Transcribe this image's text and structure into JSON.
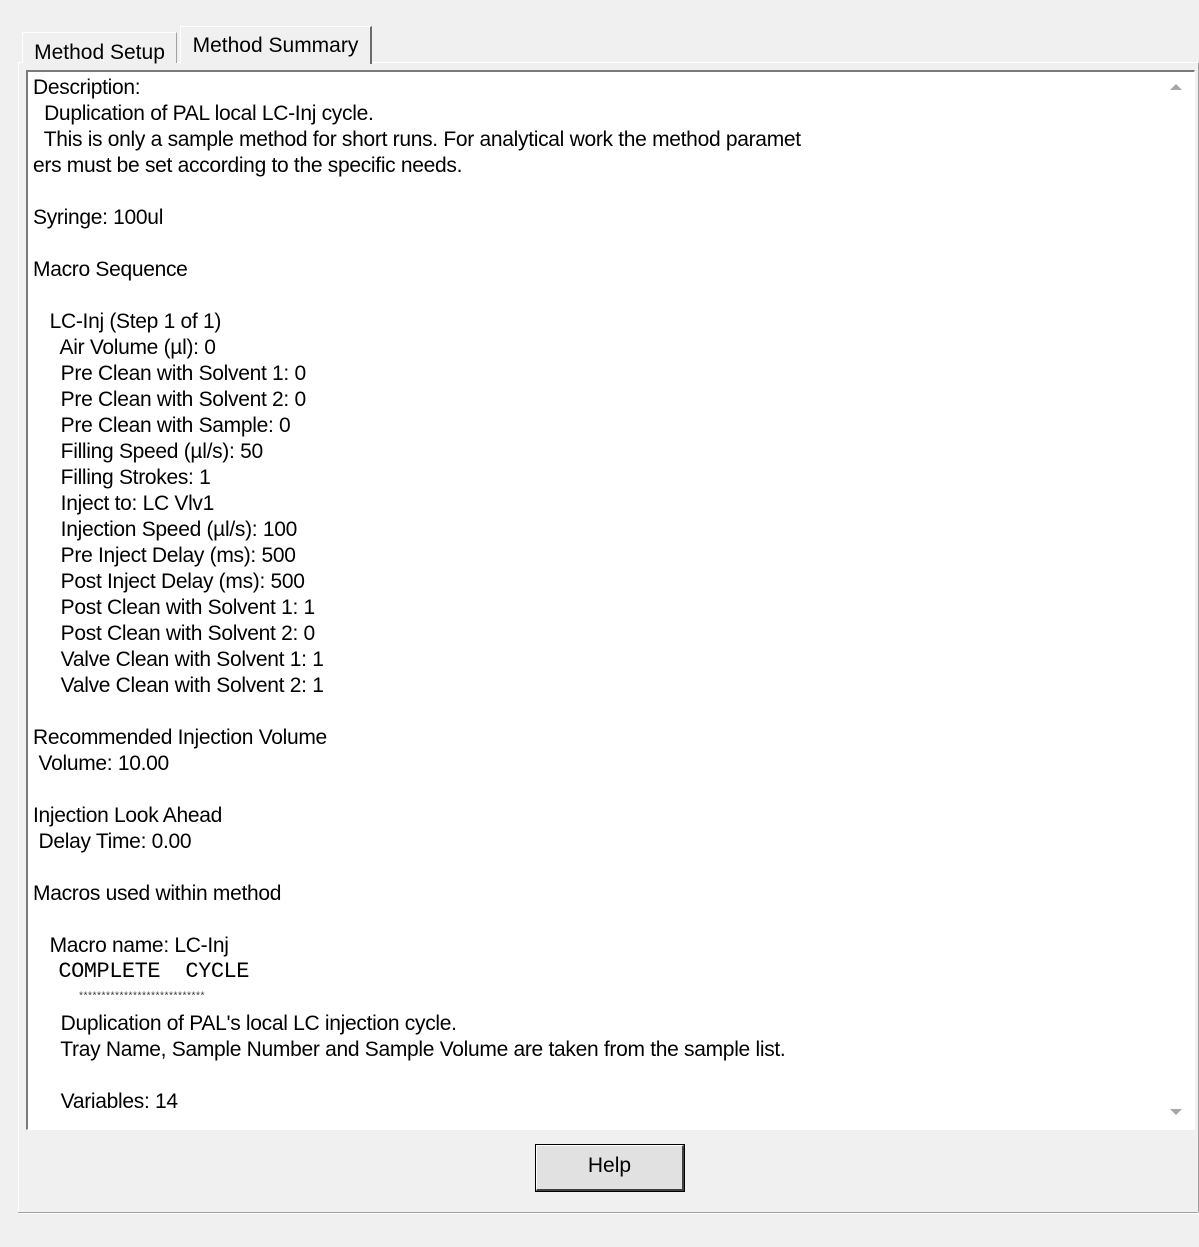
{
  "tabs": [
    {
      "label": "Method Setup",
      "active": false
    },
    {
      "label": "Method Summary",
      "active": true
    }
  ],
  "summary": {
    "lines": [
      {
        "text": "Description:",
        "style": "normal"
      },
      {
        "text": "  Duplication of PAL local LC-Inj cycle.",
        "style": "normal"
      },
      {
        "text": "  This is only a sample method for short runs. For analytical work the method paramet",
        "style": "normal"
      },
      {
        "text": "ers must be set according to the specific needs.",
        "style": "normal"
      },
      {
        "text": "",
        "style": "normal"
      },
      {
        "text": "Syringe: 100ul",
        "style": "normal"
      },
      {
        "text": "",
        "style": "normal"
      },
      {
        "text": "Macro Sequence",
        "style": "normal"
      },
      {
        "text": "",
        "style": "normal"
      },
      {
        "text": "   LC-Inj (Step 1 of 1)",
        "style": "normal"
      },
      {
        "text": "     Air Volume (µl): 0",
        "style": "normal"
      },
      {
        "text": "     Pre Clean with Solvent 1: 0",
        "style": "normal"
      },
      {
        "text": "     Pre Clean with Solvent 2: 0",
        "style": "normal"
      },
      {
        "text": "     Pre Clean with Sample: 0",
        "style": "normal"
      },
      {
        "text": "     Filling Speed (µl/s): 50",
        "style": "normal"
      },
      {
        "text": "     Filling Strokes: 1",
        "style": "normal"
      },
      {
        "text": "     Inject to: LC Vlv1",
        "style": "normal"
      },
      {
        "text": "     Injection Speed (µl/s): 100",
        "style": "normal"
      },
      {
        "text": "     Pre Inject Delay (ms): 500",
        "style": "normal"
      },
      {
        "text": "     Post Inject Delay (ms): 500",
        "style": "normal"
      },
      {
        "text": "     Post Clean with Solvent 1: 1",
        "style": "normal"
      },
      {
        "text": "     Post Clean with Solvent 2: 0",
        "style": "normal"
      },
      {
        "text": "     Valve Clean with Solvent 1: 1",
        "style": "normal"
      },
      {
        "text": "     Valve Clean with Solvent 2: 1",
        "style": "normal"
      },
      {
        "text": "",
        "style": "normal"
      },
      {
        "text": "Recommended Injection Volume",
        "style": "normal"
      },
      {
        "text": " Volume: 10.00",
        "style": "normal"
      },
      {
        "text": "",
        "style": "normal"
      },
      {
        "text": "Injection Look Ahead",
        "style": "normal"
      },
      {
        "text": " Delay Time: 0.00",
        "style": "normal"
      },
      {
        "text": "",
        "style": "normal"
      },
      {
        "text": "Macros used within method",
        "style": "normal"
      },
      {
        "text": "",
        "style": "normal"
      },
      {
        "text": "   Macro name: LC-Inj",
        "style": "normal"
      },
      {
        "text": "  COMPLETE  CYCLE",
        "style": "mono"
      },
      {
        "text": "          ****************************",
        "style": "tiny"
      },
      {
        "text": "     Duplication of PAL's local LC injection cycle.",
        "style": "normal"
      },
      {
        "text": "     Tray Name, Sample Number and Sample Volume are taken from the sample list.",
        "style": "normal"
      },
      {
        "text": "",
        "style": "normal"
      },
      {
        "text": "     Variables: 14",
        "style": "normal"
      }
    ]
  },
  "buttons": {
    "help_label": "Help"
  }
}
